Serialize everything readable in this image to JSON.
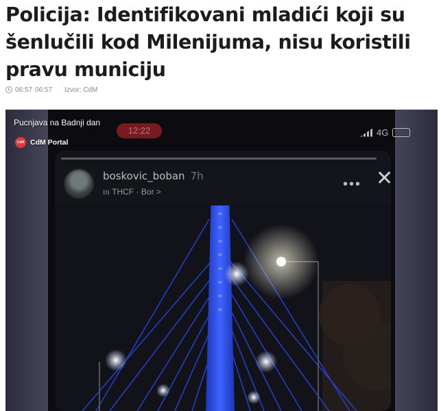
{
  "article": {
    "headline": "Policija: Identifikovani mladići koji su šenlučili kod Milenijuma, nisu koristili pravu municiju",
    "time_1": "06:57",
    "time_2": "06:57",
    "source": "Izvor: CdM"
  },
  "video": {
    "title": "Pucnjava na Badnji dan",
    "channel_name": "CdM Portal",
    "channel_logo_text": "CdM",
    "phone": {
      "time": "12:22",
      "network": "4G",
      "story_user": "boskovic_boban",
      "story_age": "7h",
      "story_music": "ııı THCF · Bor >"
    }
  },
  "icons": {
    "clock": "clock-icon",
    "more": "more-horizontal-icon",
    "close": "close-icon"
  }
}
